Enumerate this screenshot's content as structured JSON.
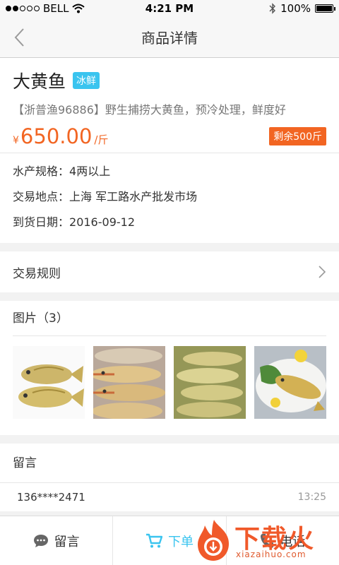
{
  "status_bar": {
    "carrier": "BELL",
    "time": "4:21 PM",
    "battery": "100%",
    "battery_level": 1.0
  },
  "nav": {
    "title": "商品详情"
  },
  "product": {
    "name": "大黄鱼",
    "tag": "冰鲜",
    "seller": "【浙普渔96886】",
    "description": "野生捕捞大黄鱼，预冷处理，鲜度好",
    "price_symbol": "¥",
    "price": "650.00",
    "unit": "/斤",
    "stock": "剩余500斤"
  },
  "specs": [
    {
      "label": "水产规格：",
      "value": "4两以上"
    },
    {
      "label": "交易地点：",
      "value": "上海 军工路水产批发市场"
    },
    {
      "label": "到货日期：",
      "value": "2016-09-12"
    }
  ],
  "rules": {
    "label": "交易规则"
  },
  "photos": {
    "header": "图片（3）"
  },
  "comments": {
    "header": "留言",
    "items": [
      {
        "user": "136****2471",
        "time": "13:25"
      }
    ]
  },
  "bottom_bar": {
    "message_label": "留言",
    "order_label": "下单",
    "call_label": "电话"
  },
  "watermark": {
    "text": "下载火",
    "url": "xiazaihuo.com"
  },
  "colors": {
    "accent": "#3ac4ef",
    "price": "#f26522",
    "watermark": "#f0592a"
  }
}
